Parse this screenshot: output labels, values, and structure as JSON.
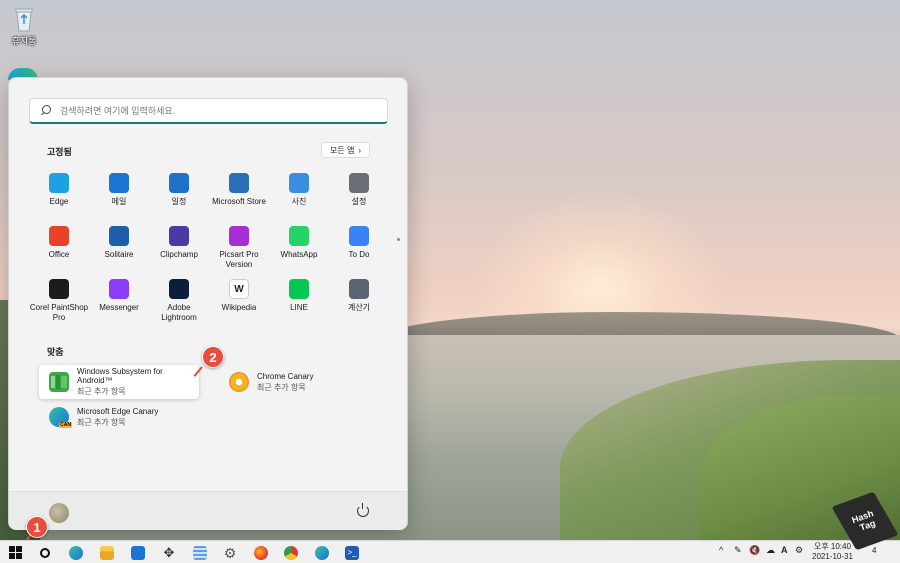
{
  "desktop": {
    "recycle_bin_label": "휴지통"
  },
  "start_menu": {
    "search_placeholder": "검색하려면 여기에 입력하세요.",
    "pinned_title": "고정됨",
    "all_apps_label": "모든 앱",
    "pinned_apps": [
      {
        "name": "Edge",
        "icon": "edge-icon",
        "color": "#1da1e2"
      },
      {
        "name": "메일",
        "icon": "mail-icon",
        "color": "#1a74d1"
      },
      {
        "name": "일정",
        "icon": "calendar-icon",
        "color": "#1e72c9"
      },
      {
        "name": "Microsoft Store",
        "icon": "store-icon",
        "color": "#2b6fb6"
      },
      {
        "name": "사진",
        "icon": "photos-icon",
        "color": "#3a8ee0"
      },
      {
        "name": "설정",
        "icon": "settings-icon",
        "color": "#6b6f75"
      },
      {
        "name": "Office",
        "icon": "office-icon",
        "color": "#e5432a"
      },
      {
        "name": "Solitaire",
        "icon": "solitaire-icon",
        "color": "#1d5fa8"
      },
      {
        "name": "Clipchamp",
        "icon": "clipchamp-icon",
        "color": "#4a3aa8"
      },
      {
        "name": "Picsart Pro Version",
        "icon": "picsart-icon",
        "color": "#a52fd4"
      },
      {
        "name": "WhatsApp",
        "icon": "whatsapp-icon",
        "color": "#25d366"
      },
      {
        "name": "To Do",
        "icon": "todo-icon",
        "color": "#3b82f6"
      },
      {
        "name": "Corel PaintShop Pro",
        "icon": "paintshop-icon",
        "color": "#1c1c1c"
      },
      {
        "name": "Messenger",
        "icon": "messenger-icon",
        "color": "#8b3cf7"
      },
      {
        "name": "Adobe Lightroom",
        "icon": "lightroom-icon",
        "color": "#0b1e3a"
      },
      {
        "name": "Wikipedia",
        "icon": "wikipedia-icon",
        "color": "#ffffff"
      },
      {
        "name": "LINE",
        "icon": "line-icon",
        "color": "#06c755"
      },
      {
        "name": "계산기",
        "icon": "calculator-icon",
        "color": "#5b6470"
      }
    ],
    "recommended_title": "맞춤",
    "recommended": [
      {
        "title": "Windows Subsystem for Android™",
        "subtitle": "최근 추가 항목",
        "icon": "wsa-icon",
        "color": "#3aa845"
      },
      {
        "title": "Chrome Canary",
        "subtitle": "최근 추가 항목",
        "icon": "chrome-canary-icon",
        "color": "#f5b323"
      },
      {
        "title": "Microsoft Edge Canary",
        "subtitle": "최근 추가 항목",
        "icon": "edge-canary-icon",
        "color": "#1da1e2"
      }
    ]
  },
  "annotations": {
    "badge_1": "1",
    "badge_2": "2"
  },
  "taskbar": {
    "clock_time": "오후 10:40",
    "clock_date": "2021-10-31",
    "ime_label": "A",
    "notification_count": "4"
  },
  "watermark": {
    "line1": "Hash",
    "line2": "Tag"
  }
}
